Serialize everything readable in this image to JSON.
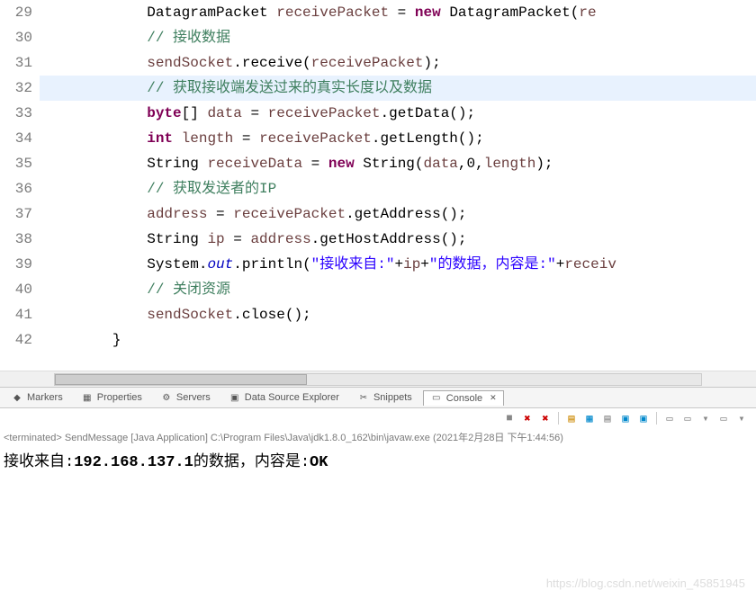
{
  "gutter": {
    "start": 29,
    "end": 42
  },
  "code": {
    "lines": [
      {
        "indent": "            ",
        "tokens": [
          [
            "type",
            "DatagramPacket"
          ],
          [
            "",
            " "
          ],
          [
            "var",
            "receivePacket"
          ],
          [
            "",
            " = "
          ],
          [
            "kw",
            "new"
          ],
          [
            "",
            " "
          ],
          [
            "type",
            "DatagramPacket"
          ],
          [
            "",
            "("
          ],
          [
            "var",
            "re"
          ]
        ]
      },
      {
        "indent": "            ",
        "tokens": [
          [
            "comment",
            "// 接收数据"
          ]
        ]
      },
      {
        "indent": "            ",
        "tokens": [
          [
            "var",
            "sendSocket"
          ],
          [
            "",
            ".receive("
          ],
          [
            "var",
            "receivePacket"
          ],
          [
            "",
            ");"
          ]
        ]
      },
      {
        "indent": "            ",
        "highlight": true,
        "tokens": [
          [
            "comment",
            "// 获取接收端发送过来的真实长度以及数据"
          ]
        ]
      },
      {
        "indent": "            ",
        "tokens": [
          [
            "kw",
            "byte"
          ],
          [
            "",
            "[] "
          ],
          [
            "var",
            "data"
          ],
          [
            "",
            " = "
          ],
          [
            "var",
            "receivePacket"
          ],
          [
            "",
            ".getData();"
          ]
        ]
      },
      {
        "indent": "            ",
        "tokens": [
          [
            "kw",
            "int"
          ],
          [
            "",
            " "
          ],
          [
            "var",
            "length"
          ],
          [
            "",
            " = "
          ],
          [
            "var",
            "receivePacket"
          ],
          [
            "",
            ".getLength();"
          ]
        ]
      },
      {
        "indent": "            ",
        "tokens": [
          [
            "type",
            "String"
          ],
          [
            "",
            " "
          ],
          [
            "var",
            "receiveData"
          ],
          [
            "",
            " = "
          ],
          [
            "kw",
            "new"
          ],
          [
            "",
            " String("
          ],
          [
            "var",
            "data"
          ],
          [
            "",
            ",0,"
          ],
          [
            "var",
            "length"
          ],
          [
            "",
            ");"
          ]
        ]
      },
      {
        "indent": "            ",
        "tokens": [
          [
            "comment",
            "// 获取发送者的IP"
          ]
        ]
      },
      {
        "indent": "            ",
        "tokens": [
          [
            "var",
            "address"
          ],
          [
            "",
            " = "
          ],
          [
            "var",
            "receivePacket"
          ],
          [
            "",
            ".getAddress();"
          ]
        ]
      },
      {
        "indent": "            ",
        "tokens": [
          [
            "type",
            "String"
          ],
          [
            "",
            " "
          ],
          [
            "var",
            "ip"
          ],
          [
            "",
            " = "
          ],
          [
            "var",
            "address"
          ],
          [
            "",
            ".getHostAddress();"
          ]
        ]
      },
      {
        "indent": "            ",
        "tokens": [
          [
            "type",
            "System"
          ],
          [
            "",
            "."
          ],
          [
            "static",
            "out"
          ],
          [
            "",
            ".println("
          ],
          [
            "str",
            "\"接收来自:\""
          ],
          [
            "",
            "+"
          ],
          [
            "var",
            "ip"
          ],
          [
            "",
            "+"
          ],
          [
            "str",
            "\"的数据，内容是:\""
          ],
          [
            "",
            "+"
          ],
          [
            "var",
            "receiv"
          ]
        ]
      },
      {
        "indent": "            ",
        "tokens": [
          [
            "comment",
            "// 关闭资源"
          ]
        ]
      },
      {
        "indent": "            ",
        "tokens": [
          [
            "var",
            "sendSocket"
          ],
          [
            "",
            ".close();"
          ]
        ]
      },
      {
        "indent": "        ",
        "tokens": [
          [
            "",
            "}"
          ]
        ]
      }
    ]
  },
  "tabs": {
    "items": [
      {
        "icon": "◆",
        "label": "Markers"
      },
      {
        "icon": "▦",
        "label": "Properties"
      },
      {
        "icon": "⚙",
        "label": "Servers"
      },
      {
        "icon": "▣",
        "label": "Data Source Explorer"
      },
      {
        "icon": "✂",
        "label": "Snippets"
      },
      {
        "icon": "▭",
        "label": "Console",
        "active": true,
        "close": "✕"
      }
    ]
  },
  "toolbar_icons": [
    "■",
    "✖",
    "✖",
    "|",
    "▤",
    "▦",
    "▤",
    "▣",
    "▣",
    "|",
    "▭",
    "▭",
    "▾",
    "▭",
    "▾"
  ],
  "console": {
    "status_prefix": "<terminated>",
    "status_text": " SendMessage [Java Application] C:\\Program Files\\Java\\jdk1.8.0_162\\bin\\javaw.exe (2021年2月28日 下午1:44:56)",
    "out_prefix": "接收来自:",
    "out_ip": "192.168.137.1",
    "out_mid": "的数据，内容是:",
    "out_payload": "OK"
  },
  "watermark": "https://blog.csdn.net/weixin_45851945"
}
